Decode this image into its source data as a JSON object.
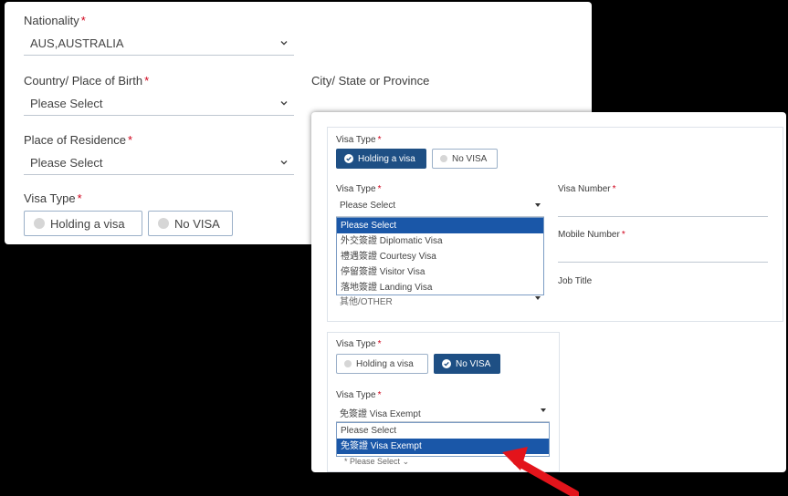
{
  "panel1": {
    "nationality": {
      "label": "Nationality",
      "value": "AUS,AUSTRALIA"
    },
    "birth": {
      "label": "Country/ Place of Birth",
      "placeholder": "Please Select"
    },
    "city": {
      "label": "City/ State or Province"
    },
    "residence": {
      "label": "Place of Residence",
      "placeholder": "Please Select"
    },
    "visa_type": {
      "label": "Visa Type",
      "options": [
        "Holding a visa",
        "No VISA"
      ]
    }
  },
  "panel2": {
    "top": {
      "visa_type_label": "Visa Type",
      "toggle": [
        "Holding a visa",
        "No VISA"
      ],
      "selected_toggle": "Holding a visa",
      "select_label": "Visa Type",
      "select_value": "Please Select",
      "dropdown_options": [
        "Please Select",
        "外交簽證 Diplomatic Visa",
        "禮遇簽證 Courtesy Visa",
        "停留簽證 Visitor Visa",
        "落地簽證 Landing Visa"
      ],
      "behind_text": "其他/OTHER",
      "visa_number_label": "Visa Number",
      "mobile_number_label": "Mobile Number",
      "job_title_label": "Job Title"
    },
    "bottom": {
      "visa_type_label": "Visa Type",
      "toggle": [
        "Holding a visa",
        "No VISA"
      ],
      "selected_toggle": "No VISA",
      "select_label": "Visa Type",
      "select_value": "免簽證 Visa Exempt",
      "dropdown_options": [
        "Please Select",
        "免簽證 Visa Exempt"
      ],
      "behind_text": "Please Select"
    }
  },
  "colors": {
    "accent": "#1e4f84",
    "required": "#d0021b",
    "highlight": "#1a57a8",
    "annotation_arrow": "#e3141b"
  }
}
